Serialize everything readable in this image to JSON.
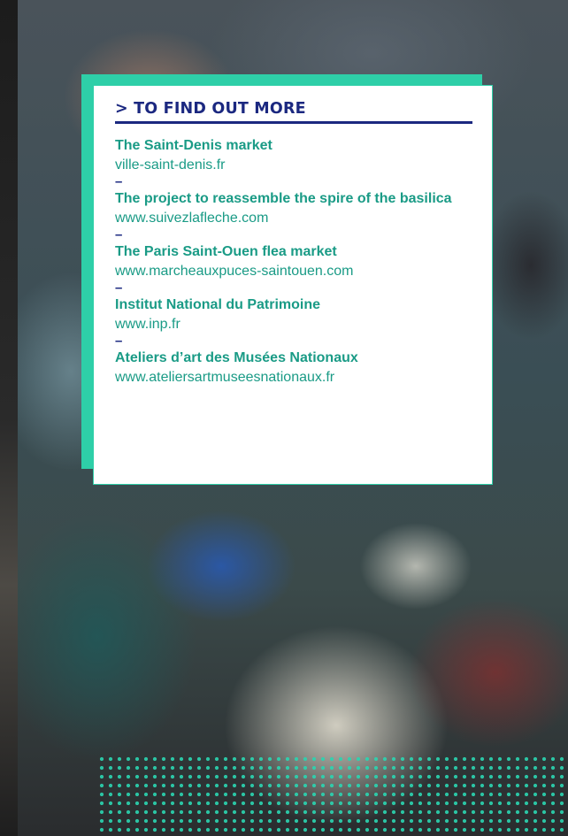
{
  "heading": "> TO FIND OUT MORE",
  "separator": "–",
  "links": [
    {
      "title": "The Saint-Denis market",
      "url": "ville-saint-denis.fr"
    },
    {
      "title": "The project to reassemble the spire of the basilica",
      "url": "www.suivezlafleche.com"
    },
    {
      "title": "The Paris Saint-Ouen flea market",
      "url": "www.marcheauxpuces-saintouen.com"
    },
    {
      "title": "Institut National du Patrimoine",
      "url": "www.inp.fr"
    },
    {
      "title": "Ateliers d’art des Musées Nationaux",
      "url": "www.ateliersartmuseesnationaux.fr"
    }
  ],
  "colors": {
    "accent_teal": "#2ecfa8",
    "link_teal": "#1a9b86",
    "heading_navy": "#1b2880"
  },
  "image_subject": "restorer-painting-photo"
}
